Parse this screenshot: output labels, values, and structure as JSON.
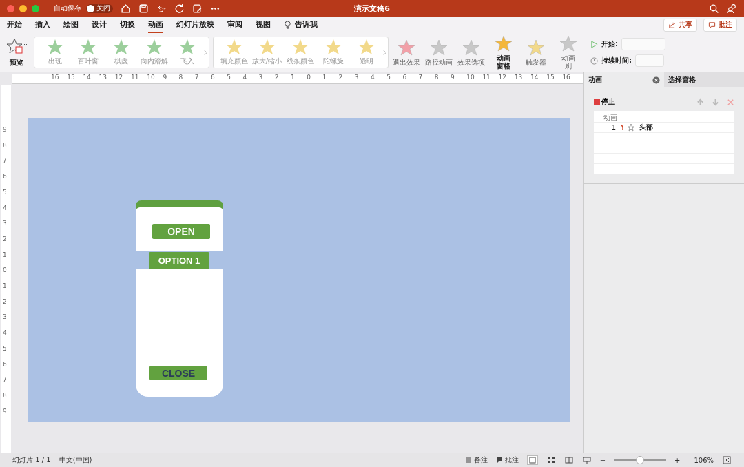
{
  "window": {
    "title": "演示文稿6",
    "autosave_label": "自动保存",
    "autosave": {
      "on": false,
      "label": "关闭"
    }
  },
  "tabs": [
    {
      "label": "开始",
      "selected": false
    },
    {
      "label": "插入",
      "selected": false
    },
    {
      "label": "绘图",
      "selected": false
    },
    {
      "label": "设计",
      "selected": false
    },
    {
      "label": "切换",
      "selected": false
    },
    {
      "label": "动画",
      "selected": true
    },
    {
      "label": "幻灯片放映",
      "selected": false
    },
    {
      "label": "审阅",
      "selected": false
    },
    {
      "label": "视图",
      "selected": false
    }
  ],
  "tell_me": "告诉我",
  "share_button": "共享",
  "comments_button": "批注",
  "ribbon": {
    "preview": "预览",
    "galleries": [
      {
        "color": "#9ccf9c",
        "effects": [
          "出现",
          "百叶窗",
          "棋盘",
          "向内溶解",
          "飞入"
        ]
      },
      {
        "color": "#f2d98a",
        "effects": [
          "填充颜色",
          "放大/缩小",
          "线条颜色",
          "陀螺旋",
          "透明"
        ]
      }
    ],
    "tools": [
      {
        "label": "退出效果",
        "color": "#f2a0a8",
        "bold": false,
        "stacked": false
      },
      {
        "label": "路径动画",
        "color": "#c8c8c8",
        "bold": false,
        "stacked": false
      },
      {
        "label": "效果选项",
        "color": "#c8c8c8",
        "bold": false,
        "stacked": false
      },
      {
        "label": "动画窗格",
        "color": "#f4b73a",
        "bold": true,
        "stacked": true
      },
      {
        "label": "触发器",
        "color": "#f2d98a",
        "bold": false,
        "stacked": false
      },
      {
        "label": "动画刷",
        "color": "#c8c8c8",
        "bold": false,
        "stacked": true
      }
    ],
    "start_label": "开始:",
    "duration_label": "持续时间:"
  },
  "ruler": {
    "horizontal": [
      "16",
      "15",
      "14",
      "13",
      "12",
      "11",
      "10",
      "9",
      "8",
      "7",
      "6",
      "5",
      "4",
      "3",
      "2",
      "1",
      "0",
      "1",
      "2",
      "3",
      "4",
      "5",
      "6",
      "7",
      "8",
      "9",
      "10",
      "11",
      "12",
      "13",
      "14",
      "15",
      "16"
    ],
    "vertical": [
      "9",
      "8",
      "7",
      "6",
      "5",
      "4",
      "3",
      "2",
      "1",
      "0",
      "1",
      "2",
      "3",
      "4",
      "5",
      "6",
      "7",
      "8",
      "9"
    ]
  },
  "slide": {
    "open_button": "OPEN",
    "option_button": "OPTION 1",
    "close_button": "CLOSE"
  },
  "pane": {
    "tabs": [
      {
        "label": "动画",
        "selected": true
      },
      {
        "label": "选择窗格",
        "selected": false
      }
    ],
    "stop_button": "停止",
    "list_header": "动画",
    "items": [
      {
        "number": "1",
        "name": "头部"
      }
    ]
  },
  "status_bar": {
    "slide": "幻灯片 1 / 1",
    "language": "中文(中国)",
    "notes": "备注",
    "comments": "批注",
    "zoom_out": "−",
    "zoom": {
      "level": 0.5
    },
    "zoom_in": "+",
    "zoom_percent": "106%"
  }
}
